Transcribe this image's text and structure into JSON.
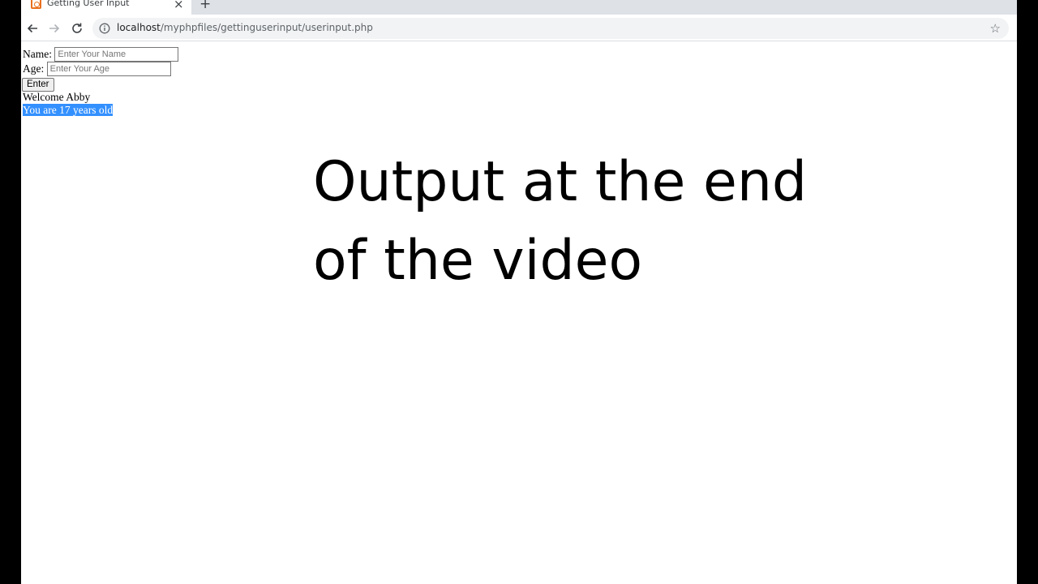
{
  "browser": {
    "tab": {
      "title": "Getting User Input",
      "close_glyph": "×",
      "favicon": "xampp-icon"
    },
    "new_tab_glyph": "+",
    "address": {
      "host": "localhost",
      "path": "/myphpfiles/gettinguserinput/userinput.php"
    },
    "star_glyph": "☆"
  },
  "page": {
    "name_label": "Name:",
    "name_placeholder": "Enter Your Name",
    "name_value": "",
    "age_label": "Age:",
    "age_placeholder": "Enter Your Age",
    "age_value": "",
    "enter_button": "Enter",
    "welcome_text": "Welcome Abby",
    "age_text": "You are 17 years old"
  },
  "overlay": {
    "line1": "Output at the end",
    "line2": "of the video"
  },
  "colors": {
    "selection": "#3390ff",
    "favicon_accent": "#e8701f",
    "tabstrip": "#dee1e6"
  }
}
